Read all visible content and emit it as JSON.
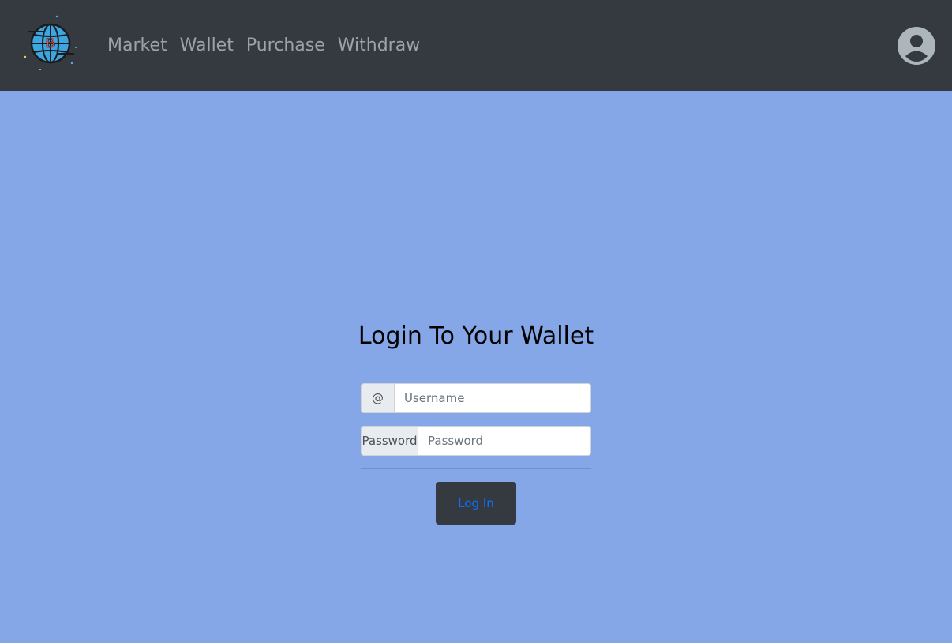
{
  "nav": {
    "brand_icon": "globe-bitcoin-logo",
    "links": [
      "Market",
      "Wallet",
      "Purchase",
      "Withdraw"
    ],
    "avatar_icon": "user-circle-icon",
    "background": "#343a40",
    "link_color": "#9fa3a8"
  },
  "login": {
    "title": "Login To Your Wallet",
    "username_addon": "@",
    "username_placeholder": "Username",
    "password_addon": "Password",
    "password_placeholder": "Password",
    "button_label": "Log In",
    "button_text_color": "#0d6efd"
  },
  "page": {
    "background": "#85a7e7"
  }
}
